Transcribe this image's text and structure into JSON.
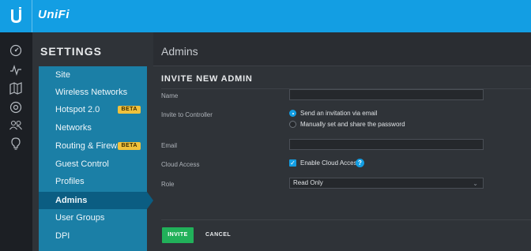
{
  "topbar": {
    "brand": "UniFi",
    "logo_icon": "ubiquiti-u-logo",
    "accent": "#139ee3"
  },
  "rail": {
    "icons": [
      "dashboard-icon",
      "statistics-icon",
      "map-icon",
      "devices-icon",
      "clients-icon",
      "insights-icon"
    ]
  },
  "settings": {
    "title": "SETTINGS",
    "items": [
      {
        "label": "Site"
      },
      {
        "label": "Wireless Networks"
      },
      {
        "label": "Hotspot 2.0",
        "badge": "BETA"
      },
      {
        "label": "Networks"
      },
      {
        "label": "Routing & Firewall",
        "badge": "BETA"
      },
      {
        "label": "Guest Control"
      },
      {
        "label": "Profiles"
      },
      {
        "label": "Admins",
        "active": true
      },
      {
        "label": "User Groups"
      },
      {
        "label": "DPI"
      }
    ],
    "nav_color": "#1b7fa6",
    "active_color": "#0b5d82",
    "badge_color": "#f0c13c"
  },
  "main": {
    "page_title": "Admins",
    "section_title": "INVITE NEW ADMIN",
    "labels": {
      "name": "Name",
      "invite": "Invite to Controller",
      "email": "Email",
      "cloud": "Cloud Access",
      "role": "Role"
    },
    "fields": {
      "name_value": "",
      "email_value": "",
      "role_value": "Read Only"
    },
    "invite_options": [
      {
        "label": "Send an invitation via email",
        "selected": true
      },
      {
        "label": "Manually set and share the password",
        "selected": false
      }
    ],
    "cloud_access": {
      "label": "Enable Cloud Access",
      "checked": true,
      "help": "?"
    },
    "buttons": {
      "invite": "INVITE",
      "cancel": "CANCEL"
    },
    "invite_color": "#21b15a"
  }
}
